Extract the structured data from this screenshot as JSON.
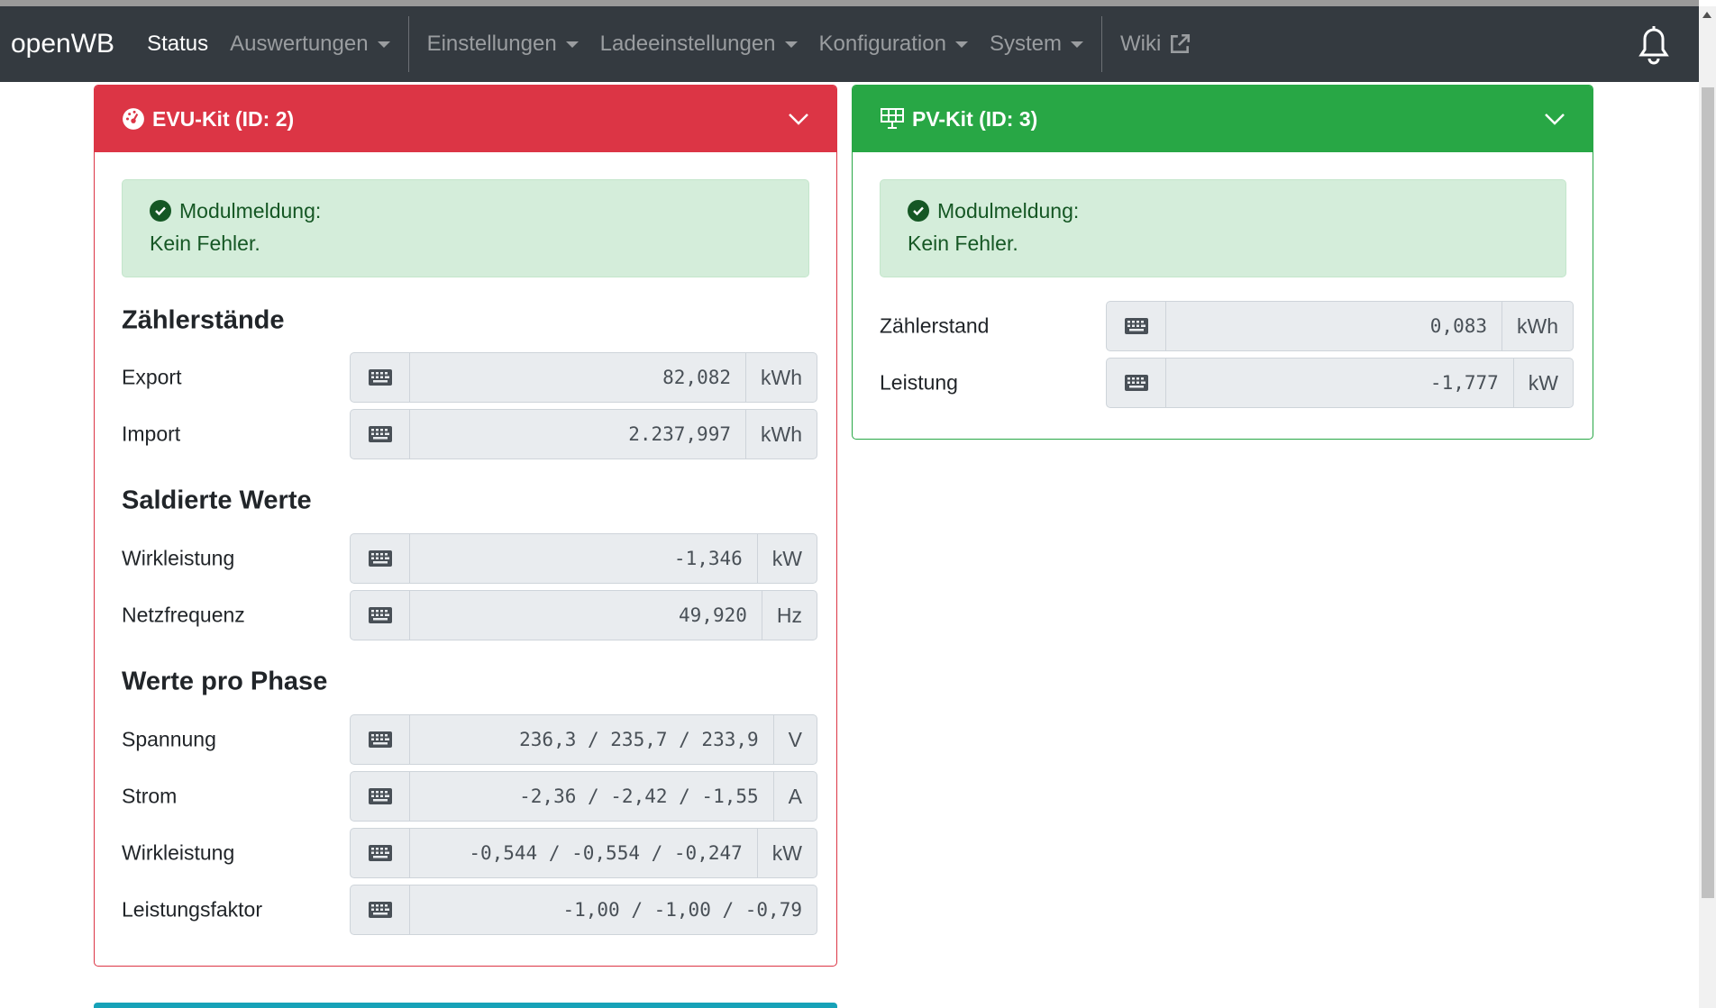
{
  "nav": {
    "brand": "openWB",
    "items": [
      {
        "label": "Status"
      },
      {
        "label": "Auswertungen"
      },
      {
        "label": "Einstellungen"
      },
      {
        "label": "Ladeeinstellungen"
      },
      {
        "label": "Konfiguration"
      },
      {
        "label": "System"
      },
      {
        "label": "Wiki"
      }
    ]
  },
  "colors": {
    "evu": "#dc3545",
    "pv": "#28a745",
    "nav": "#343a40"
  },
  "evu": {
    "title": "EVU-Kit (ID: 2)",
    "alert_title": "Modulmeldung:",
    "alert_text": "Kein Fehler.",
    "sections": [
      {
        "heading": "Zählerstände",
        "rows": [
          {
            "label": "Export",
            "value": "82,082",
            "unit": "kWh"
          },
          {
            "label": "Import",
            "value": "2.237,997",
            "unit": "kWh"
          }
        ]
      },
      {
        "heading": "Saldierte Werte",
        "rows": [
          {
            "label": "Wirkleistung",
            "value": "-1,346",
            "unit": "kW"
          },
          {
            "label": "Netzfrequenz",
            "value": "49,920",
            "unit": "Hz"
          }
        ]
      },
      {
        "heading": "Werte pro Phase",
        "rows": [
          {
            "label": "Spannung",
            "value": "236,3 / 235,7 / 233,9",
            "unit": "V"
          },
          {
            "label": "Strom",
            "value": "-2,36 / -2,42 / -1,55",
            "unit": "A"
          },
          {
            "label": "Wirkleistung",
            "value": "-0,544 / -0,554 / -0,247",
            "unit": "kW"
          },
          {
            "label": "Leistungsfaktor",
            "value": "-1,00 / -1,00 / -0,79",
            "unit": ""
          }
        ]
      }
    ]
  },
  "pv": {
    "title": "PV-Kit (ID: 3)",
    "alert_title": "Modulmeldung:",
    "alert_text": "Kein Fehler.",
    "rows": [
      {
        "label": "Zählerstand",
        "value": "0,083",
        "unit": "kWh"
      },
      {
        "label": "Leistung",
        "value": "-1,777",
        "unit": "kW"
      }
    ]
  }
}
